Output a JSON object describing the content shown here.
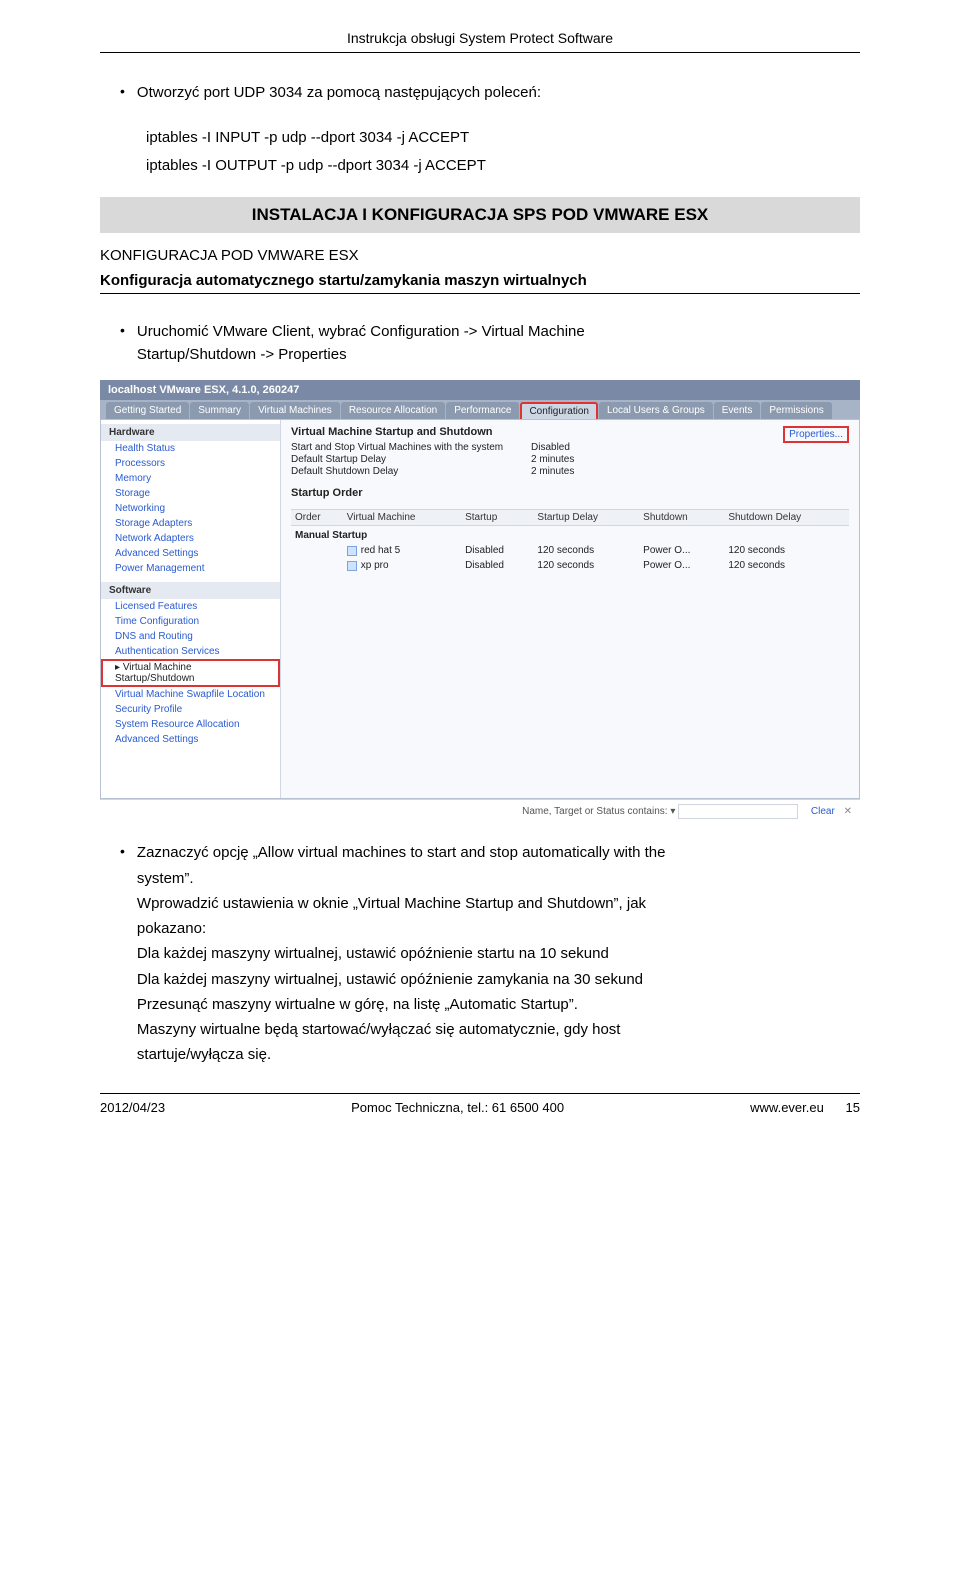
{
  "header": {
    "title": "Instrukcja obsługi System Protect Software"
  },
  "intro": {
    "bullet1": "Otworzyć port UDP 3034 za pomocą następujących poleceń:",
    "cmd1": "iptables -I INPUT -p udp --dport 3034 -j ACCEPT",
    "cmd2": "iptables -I OUTPUT -p udp --dport 3034 -j ACCEPT"
  },
  "banner": "INSTALACJA I KONFIGURACJA SPS POD VMWARE ESX",
  "sub1": "KONFIGURACJA POD VMWARE ESX",
  "sub2": "Konfiguracja automatycznego startu/zamykania maszyn wirtualnych",
  "bullet2a": "Uruchomić VMware Client, wybrać Configuration -> Virtual Machine",
  "bullet2b": "Startup/Shutdown -> Properties",
  "vm": {
    "title": "localhost VMware ESX, 4.1.0, 260247",
    "tabs": [
      "Getting Started",
      "Summary",
      "Virtual Machines",
      "Resource Allocation",
      "Performance",
      "Configuration",
      "Local Users & Groups",
      "Events",
      "Permissions"
    ],
    "properties_link": "Properties...",
    "main_title": "Virtual Machine Startup and Shutdown",
    "kv": [
      {
        "k": "Start and Stop Virtual Machines with the system",
        "v": "Disabled"
      },
      {
        "k": "Default Startup Delay",
        "v": "2 minutes"
      },
      {
        "k": "Default Shutdown Delay",
        "v": "2 minutes"
      }
    ],
    "order_title": "Startup Order",
    "cols": [
      "Order",
      "Virtual Machine",
      "Startup",
      "Startup Delay",
      "Shutdown",
      "Shutdown Delay"
    ],
    "section_row": "Manual Startup",
    "rows": [
      {
        "order": "",
        "vm": "red hat 5",
        "startup": "Disabled",
        "sdelay": "120 seconds",
        "shutdown": "Power O...",
        "shdelay": "120 seconds"
      },
      {
        "order": "",
        "vm": "xp pro",
        "startup": "Disabled",
        "sdelay": "120 seconds",
        "shutdown": "Power O...",
        "shdelay": "120 seconds"
      }
    ],
    "sidebar": {
      "hardware_head": "Hardware",
      "hardware": [
        "Health Status",
        "Processors",
        "Memory",
        "Storage",
        "Networking",
        "Storage Adapters",
        "Network Adapters",
        "Advanced Settings",
        "Power Management"
      ],
      "software_head": "Software",
      "software_pre": [
        "Licensed Features",
        "Time Configuration",
        "DNS and Routing",
        "Authentication Services"
      ],
      "software_active": "Virtual Machine Startup/Shutdown",
      "software_post": [
        "Virtual Machine Swapfile Location",
        "Security Profile",
        "System Resource Allocation",
        "Advanced Settings"
      ]
    },
    "bottom_label": "Name, Target or Status contains:  ▾",
    "bottom_clear": "Clear"
  },
  "after": {
    "b1a": "Zaznaczyć opcję „Allow virtual machines to start and stop automatically with the",
    "b1b": "system”.",
    "p2": "Wprowadzić ustawienia w oknie „Virtual Machine Startup and Shutdown”, jak",
    "p2b": "pokazano:",
    "p3": "Dla każdej maszyny wirtualnej, ustawić opóźnienie startu na 10 sekund",
    "p4": "Dla każdej maszyny wirtualnej, ustawić opóźnienie zamykania na 30 sekund",
    "p5": "Przesunąć maszyny wirtualne w górę, na listę „Automatic Startup”.",
    "p6": "Maszyny wirtualne będą startować/wyłączać się automatycznie, gdy host",
    "p6b": "startuje/wyłącza się."
  },
  "footer": {
    "left": "2012/04/23",
    "center": "Pomoc Techniczna, tel.: 61 6500 400",
    "right_a": "www.ever.eu",
    "right_b": "15"
  }
}
